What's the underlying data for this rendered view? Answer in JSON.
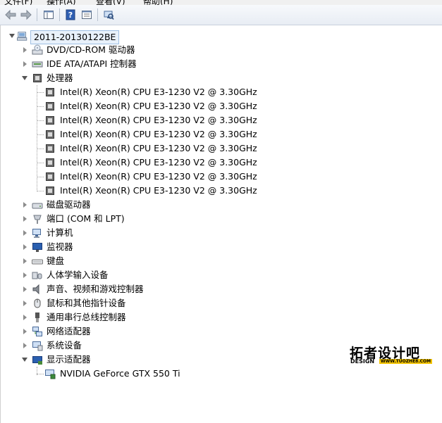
{
  "menu": [
    "文件(F)",
    "操作(A)",
    "查看(V)",
    "帮助(H)"
  ],
  "toolbar": {
    "buttons": [
      "back-icon",
      "forward-icon",
      "show-hide-tree-icon",
      "help-icon",
      "properties-icon",
      "scan-hardware-icon"
    ]
  },
  "tree": {
    "root": "2011-20130122BE",
    "categories": [
      {
        "label": "DVD/CD-ROM 驱动器",
        "icon": "dvd-drive-icon"
      },
      {
        "label": "IDE ATA/ATAPI 控制器",
        "icon": "ide-controller-icon"
      },
      {
        "label": "处理器",
        "icon": "processor-icon",
        "expanded": true,
        "children": [
          "Intel(R) Xeon(R) CPU E3-1230 V2 @ 3.30GHz",
          "Intel(R) Xeon(R) CPU E3-1230 V2 @ 3.30GHz",
          "Intel(R) Xeon(R) CPU E3-1230 V2 @ 3.30GHz",
          "Intel(R) Xeon(R) CPU E3-1230 V2 @ 3.30GHz",
          "Intel(R) Xeon(R) CPU E3-1230 V2 @ 3.30GHz",
          "Intel(R) Xeon(R) CPU E3-1230 V2 @ 3.30GHz",
          "Intel(R) Xeon(R) CPU E3-1230 V2 @ 3.30GHz",
          "Intel(R) Xeon(R) CPU E3-1230 V2 @ 3.30GHz"
        ]
      },
      {
        "label": "磁盘驱动器",
        "icon": "disk-drive-icon"
      },
      {
        "label": "端口 (COM 和 LPT)",
        "icon": "port-icon"
      },
      {
        "label": "计算机",
        "icon": "computer-icon"
      },
      {
        "label": "监视器",
        "icon": "monitor-icon"
      },
      {
        "label": "键盘",
        "icon": "keyboard-icon"
      },
      {
        "label": "人体学输入设备",
        "icon": "hid-icon"
      },
      {
        "label": "声音、视频和游戏控制器",
        "icon": "sound-icon"
      },
      {
        "label": "鼠标和其他指针设备",
        "icon": "mouse-icon"
      },
      {
        "label": "通用串行总线控制器",
        "icon": "usb-icon"
      },
      {
        "label": "网络适配器",
        "icon": "network-adapter-icon"
      },
      {
        "label": "系统设备",
        "icon": "system-device-icon"
      },
      {
        "label": "显示适配器",
        "icon": "display-adapter-icon",
        "expanded": true,
        "children": [
          "NVIDIA GeForce GTX 550 Ti"
        ]
      }
    ]
  },
  "watermark": {
    "title": "拓者设计吧",
    "sub": "DESIGN",
    "url": "WWW.TUOZHE8.COM"
  }
}
